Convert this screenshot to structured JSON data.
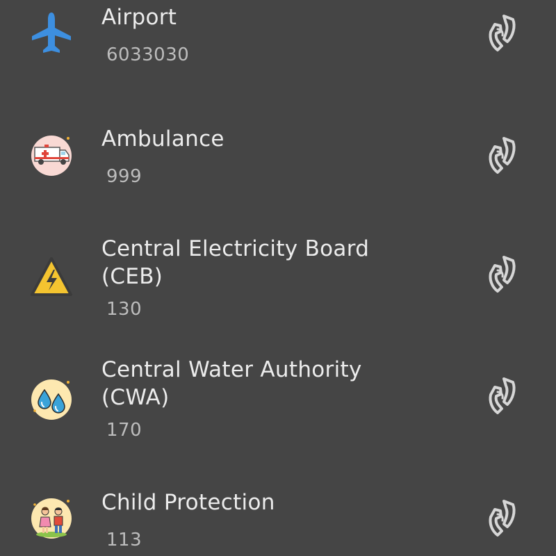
{
  "contacts": [
    {
      "name": "Airport",
      "number": "6033030",
      "icon": "airplane-icon"
    },
    {
      "name": "Ambulance",
      "number": "999",
      "icon": "ambulance-icon"
    },
    {
      "name": "Central Electricity Board (CEB)",
      "number": "130",
      "icon": "high-voltage-icon"
    },
    {
      "name": "Central Water Authority (CWA)",
      "number": "170",
      "icon": "water-drops-icon"
    },
    {
      "name": "Child Protection",
      "number": "113",
      "icon": "children-icon"
    }
  ],
  "colors": {
    "background": "#454545",
    "title": "#ececec",
    "number": "#bdbdbd",
    "call_icon": "#d6d6d6",
    "airplane": "#3d8fe0"
  }
}
